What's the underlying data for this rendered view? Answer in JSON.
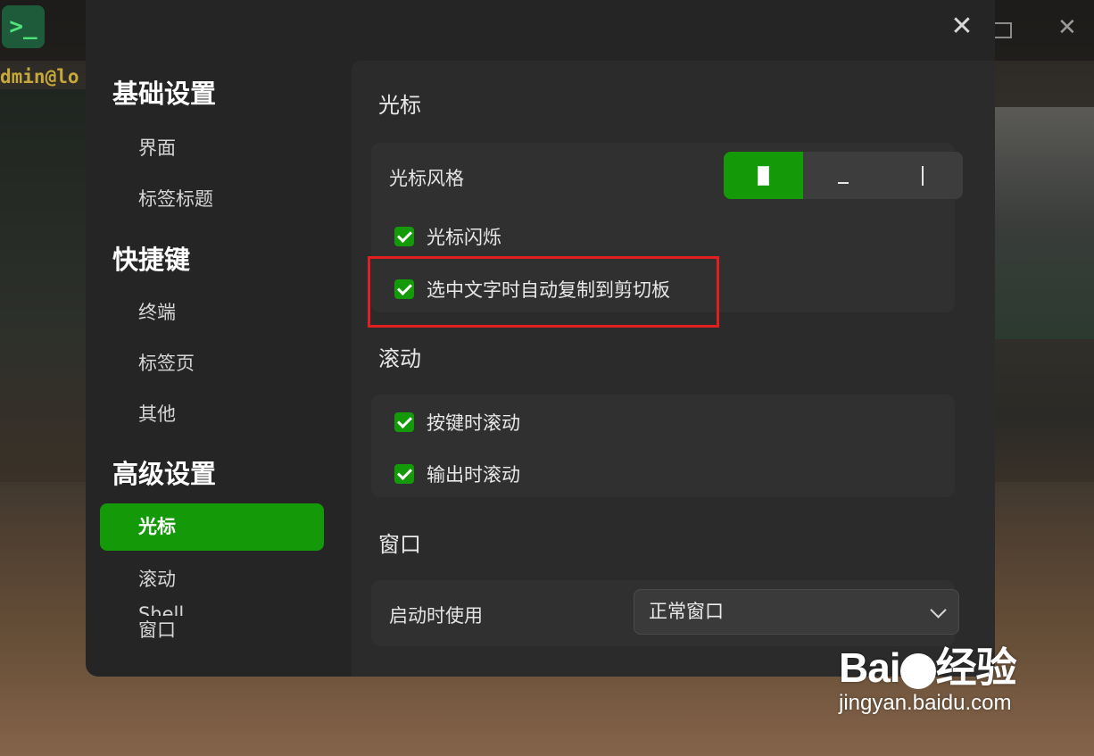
{
  "terminal": {
    "app_icon_glyph": ">_",
    "prompt_fragment": "dmin@lo"
  },
  "dialog": {
    "close_glyph": "✕"
  },
  "sidebar": {
    "groups": [
      {
        "label": "基础设置",
        "items": [
          "界面",
          "标签标题"
        ]
      },
      {
        "label": "快捷键",
        "items": [
          "终端",
          "标签页",
          "其他"
        ]
      },
      {
        "label": "高级设置",
        "items": [
          "光标",
          "滚动",
          "窗口",
          "Shell"
        ]
      }
    ],
    "active_item": "光标"
  },
  "content": {
    "cursor_section": {
      "title": "光标",
      "style_label": "光标风格",
      "style_options": [
        "block",
        "underline",
        "ibeam"
      ],
      "style_selected": "block",
      "blink_label": "光标闪烁",
      "blink_checked": true,
      "auto_copy_label": "选中文字时自动复制到剪切板",
      "auto_copy_checked": true
    },
    "scroll_section": {
      "title": "滚动",
      "on_key_label": "按键时滚动",
      "on_key_checked": true,
      "on_output_label": "输出时滚动",
      "on_output_checked": true
    },
    "window_section": {
      "title": "窗口",
      "startup_label": "启动时使用",
      "startup_value": "正常窗口"
    }
  },
  "watermark": {
    "logo_text_a": "Bai",
    "logo_text_b": "经验",
    "url": "jingyan.baidu.com"
  },
  "colors": {
    "accent": "#149a08",
    "highlight": "#e02020"
  }
}
